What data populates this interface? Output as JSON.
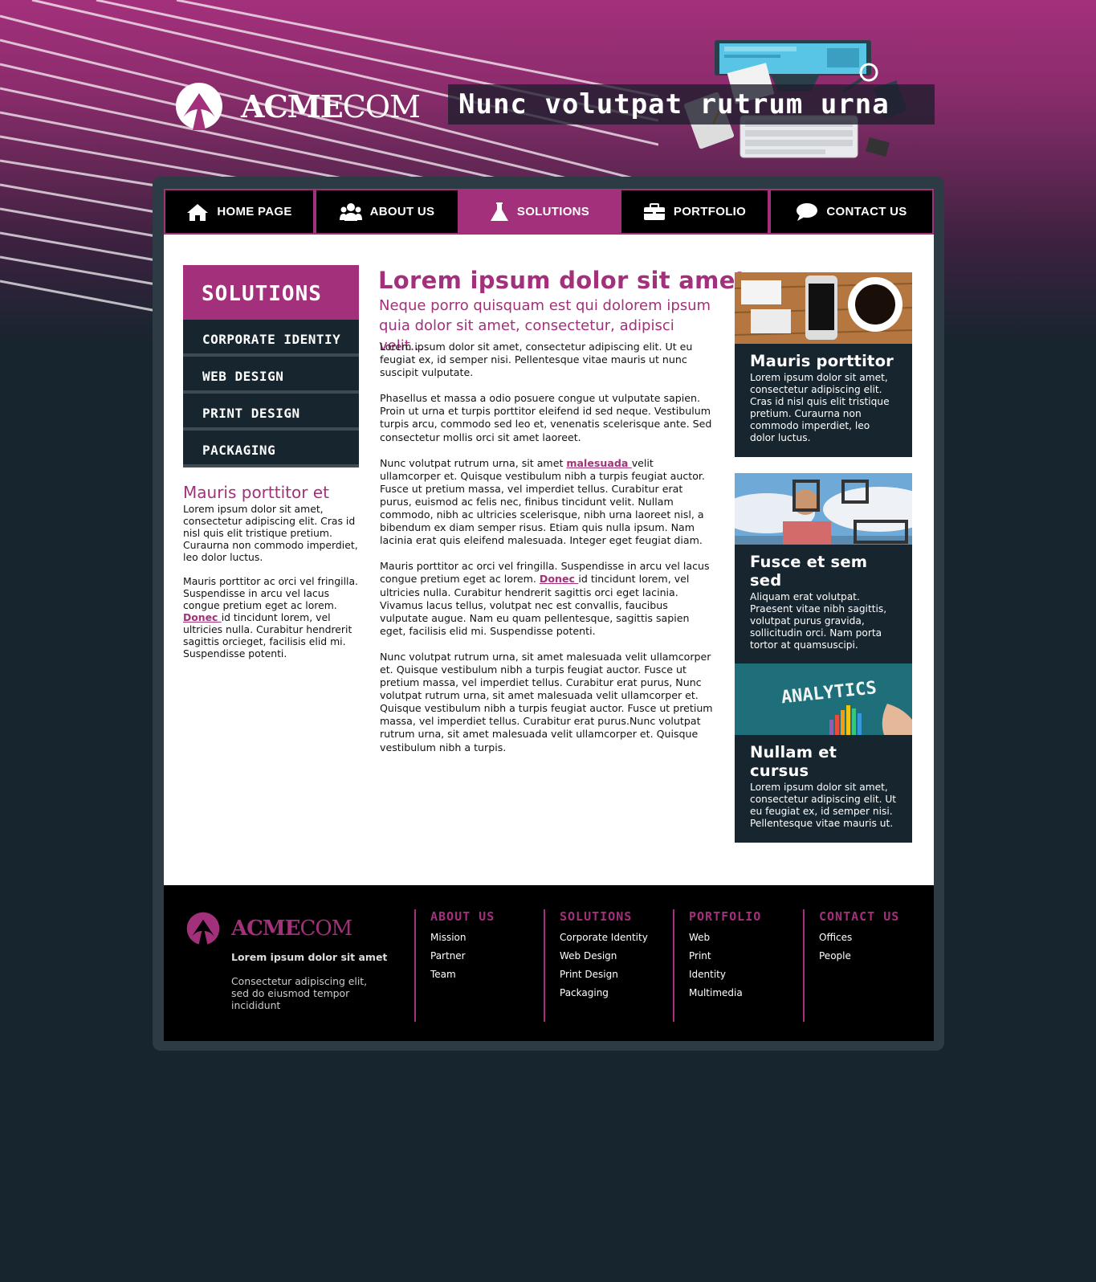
{
  "colors": {
    "accent": "#a3307b",
    "dark": "#16252e",
    "footer_bg": "#000000"
  },
  "header": {
    "logo_bold": "ACME",
    "logo_light": "COM",
    "tagline": "Nunc volutpat rutrum urna"
  },
  "nav": [
    {
      "label": "HOME PAGE",
      "icon": "home-icon",
      "active": false
    },
    {
      "label": "ABOUT US",
      "icon": "users-icon",
      "active": false
    },
    {
      "label": "SOLUTIONS",
      "icon": "flask-icon",
      "active": true
    },
    {
      "label": "PORTFOLIO",
      "icon": "briefcase-icon",
      "active": false
    },
    {
      "label": "CONTACT US",
      "icon": "speech-bubble-icon",
      "active": false
    }
  ],
  "sidebar": {
    "title": "SOLUTIONS",
    "items": [
      "CORPORATE IDENTIY",
      "WEB DESIGN",
      "PRINT DESIGN",
      "PACKAGING"
    ],
    "sub_title": "Mauris porttitor et",
    "p1": "Lorem ipsum dolor sit amet, consectetur adipiscing elit. Cras id nisl quis elit tristique pretium. Curaurna non commodo imperdiet, leo dolor luctus.",
    "p2_before": "Mauris porttitor ac orci vel fringilla. Suspendisse in arcu vel lacus congue pretium eget ac lorem. ",
    "p2_link": "Donec ",
    "p2_after": "id tincidunt lorem, vel ultricies nulla. Curabitur hendrerit sagittis orcieget, facilisis elid mi. Suspendisse potenti."
  },
  "main": {
    "title": "Lorem ipsum dolor sit amet",
    "subtitle": "Neque porro quisquam est qui dolorem ipsum quia dolor sit amet, consectetur, adipisci velit...",
    "p1": "Lorem ipsum dolor sit amet, consectetur adipiscing elit. Ut eu feugiat ex, id semper nisi. Pellentesque vitae mauris ut nunc suscipit vulputate.",
    "p2": "Phasellus et massa a odio posuere congue ut vulputate sapien. Proin ut urna et turpis porttitor eleifend id sed neque. Vestibulum turpis arcu, commodo sed leo et, venenatis scelerisque ante. Sed consectetur mollis orci sit amet laoreet.",
    "p3_before": "Nunc volutpat rutrum urna, sit amet ",
    "p3_link": "malesuada ",
    "p3_after": "velit ullamcorper et. Quisque vestibulum nibh a turpis feugiat auctor. Fusce ut pretium massa, vel imperdiet tellus. Curabitur erat purus, euismod ac felis nec, finibus tincidunt velit. Nullam commodo, nibh ac ultricies scelerisque, nibh urna laoreet nisl, a bibendum ex diam semper risus. Etiam quis nulla ipsum. Nam lacinia erat quis eleifend malesuada. Integer eget feugiat diam.",
    "p4_before": "Mauris porttitor ac orci vel fringilla. Suspendisse in arcu vel lacus congue pretium eget ac lorem. ",
    "p4_link": "Donec ",
    "p4_after": "id tincidunt lorem, vel ultricies nulla. Curabitur hendrerit sagittis orci eget lacinia. Vivamus lacus tellus, volutpat nec est convallis, faucibus vulputate augue. Nam eu quam pellentesque, sagittis sapien eget, facilisis elid mi. Suspendisse potenti.",
    "p5": "Nunc volutpat rutrum urna, sit amet malesuada velit ullamcorper et. Quisque vestibulum nibh a turpis feugiat auctor. Fusce ut pretium massa, vel imperdiet tellus. Curabitur erat purus, Nunc volutpat rutrum urna, sit amet malesuada velit ullamcorper et. Quisque vestibulum nibh a turpis feugiat auctor. Fusce ut pretium massa, vel imperdiet tellus. Curabitur erat purus.Nunc volutpat rutrum urna, sit amet malesuada velit ullamcorper et. Quisque vestibulum nibh a turpis."
  },
  "cards": [
    {
      "title": "Mauris porttitor",
      "text": "Lorem ipsum dolor sit amet, consectetur adipiscing elit. Cras id nisl quis elit tristique pretium. Curaurna non commodo imperdiet, leo dolor luctus."
    },
    {
      "title": "Fusce et sem sed",
      "text": "Aliquam erat volutpat. Praesent vitae nibh sagittis, volutpat purus gravida, sollicitudin orci. Nam porta tortor at quamsuscipi."
    },
    {
      "title": "Nullam et cursus",
      "text": "Lorem ipsum dolor sit amet, consectetur adipiscing elit. Ut eu feugiat ex, id semper nisi. Pellentesque vitae mauris ut.",
      "image_text": "ANALYTICS"
    }
  ],
  "footer": {
    "logo_bold": "ACME",
    "logo_light": "COM",
    "tagline": "Lorem ipsum dolor sit amet",
    "desc": "Consectetur adipiscing elit, sed do eiusmod tempor incididunt",
    "columns": [
      {
        "title": "ABOUT US",
        "links": [
          "Mission",
          "Partner",
          "Team"
        ]
      },
      {
        "title": "SOLUTIONS",
        "links": [
          "Corporate Identity",
          "Web Design",
          "Print Design",
          "Packaging"
        ]
      },
      {
        "title": "PORTFOLIO",
        "links": [
          "Web",
          "Print",
          "Identity",
          "Multimedia"
        ]
      },
      {
        "title": "CONTACT US",
        "links": [
          "Offices",
          "People"
        ]
      }
    ]
  }
}
